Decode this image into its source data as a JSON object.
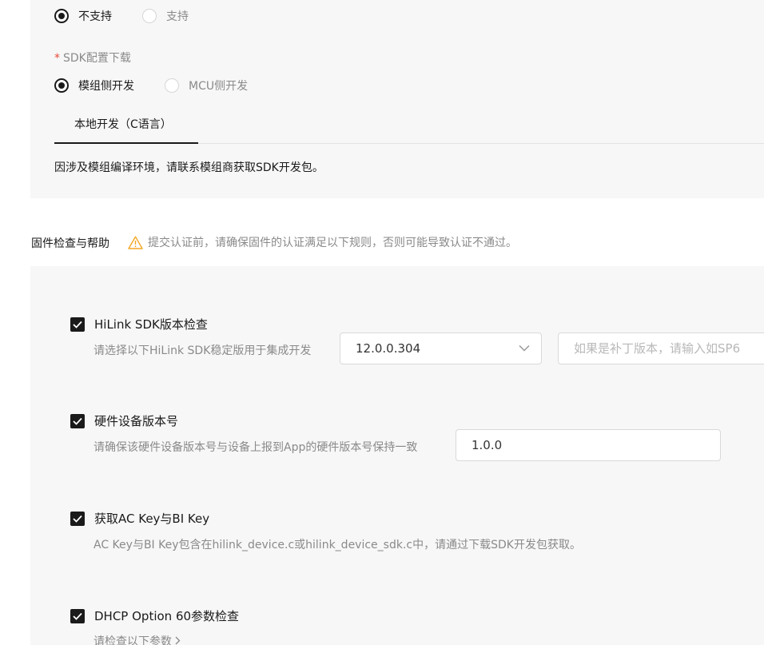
{
  "support_radio": {
    "options": [
      {
        "label": "不支持",
        "checked": true
      },
      {
        "label": "支持",
        "checked": false
      }
    ]
  },
  "sdk_config": {
    "label": "SDK配置下载",
    "required_mark": "*",
    "options": [
      {
        "label": "模组侧开发",
        "checked": true
      },
      {
        "label": "MCU侧开发",
        "checked": false
      }
    ],
    "tab": "本地开发（C语言）",
    "note": "因涉及模组编译环境，请联系模组商获取SDK开发包。"
  },
  "firmware": {
    "title": "固件检查与帮助",
    "warning": "提交认证前，请确保固件的认证满足以下规则，否则可能导致认证不通过。",
    "items": [
      {
        "title": "HiLink SDK版本检查",
        "desc": "请选择以下HiLink SDK稳定版用于集成开发",
        "select_value": "12.0.0.304",
        "patch_placeholder": "如果是补丁版本，请输入如SP6"
      },
      {
        "title": "硬件设备版本号",
        "desc": "请确保该硬件设备版本号与设备上报到App的硬件版本号保持一致",
        "input_value": "1.0.0"
      },
      {
        "title": "获取AC Key与BI Key",
        "desc": "AC Key与BI Key包含在hilink_device.c或hilink_device_sdk.c中，请通过下载SDK开发包获取。"
      },
      {
        "title": "DHCP Option 60参数检查",
        "desc": "请检查以下参数"
      }
    ]
  },
  "colors": {
    "panel_bg": "#f7f7f7",
    "text": "#1a1a1a",
    "muted": "#8a8a8a",
    "required": "#e84a3c",
    "warning_icon": "#f5a623"
  }
}
